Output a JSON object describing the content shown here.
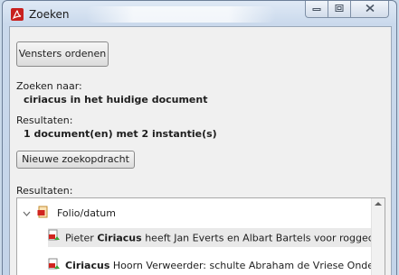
{
  "window": {
    "title": "Zoeken",
    "app_icon": "acrobat-icon",
    "controls": {
      "minimize_icon": "minimize-icon",
      "maximize_icon": "maximize-icon",
      "close_icon": "close-icon"
    }
  },
  "toolbar": {
    "arrange_label": "Vensters ordenen"
  },
  "search": {
    "search_for_label": "Zoeken naar:",
    "search_for_value": "ciriacus in het huidige document",
    "results_label": "Resultaten:",
    "results_value": "1 document(en) met 2 instantie(s)",
    "new_search_label": "Nieuwe zoekopdracht"
  },
  "results_list": {
    "label": "Resultaten:",
    "group": {
      "expander_icon": "chevron-down-icon",
      "icon": "pdf-document-icon",
      "label": "Folio/datum"
    },
    "hits": [
      {
        "icon": "search-hit-icon",
        "before": "Pieter ",
        "match": "Ciriacus",
        "after": " heeft Jan Everts en Albart Bartels voor roggedieven uit",
        "selected": true
      },
      {
        "icon": "search-hit-icon",
        "before": "",
        "match": "Ciriacus",
        "after": " Hoorn Verweerder: schulte Abraham de Vriese Onderwerp: p",
        "selected": false
      }
    ],
    "scroll_up_icon": "scroll-up-arrow-icon"
  }
}
